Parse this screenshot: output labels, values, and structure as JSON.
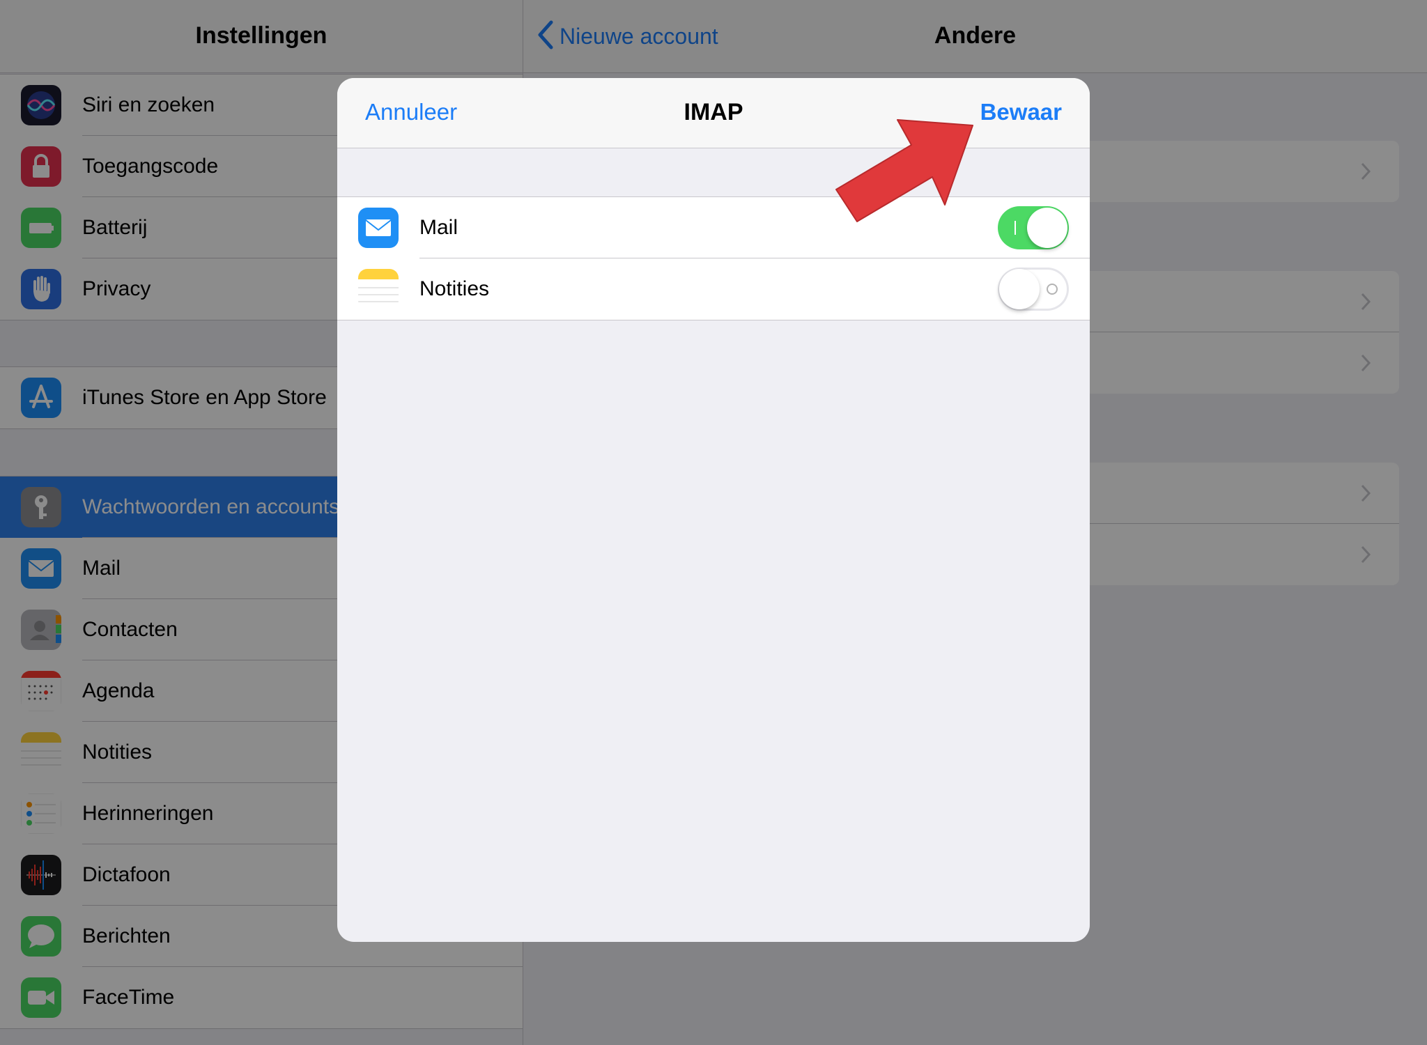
{
  "sidebar": {
    "title": "Instellingen",
    "groups": [
      [
        {
          "label": "Siri en zoeken",
          "icon": "siri-icon"
        },
        {
          "label": "Toegangscode",
          "icon": "lock-icon"
        },
        {
          "label": "Batterij",
          "icon": "battery-icon"
        },
        {
          "label": "Privacy",
          "icon": "hand-icon"
        }
      ],
      [
        {
          "label": "iTunes Store en App Store",
          "icon": "app-store-icon"
        }
      ],
      [
        {
          "label": "Wachtwoorden en accounts",
          "icon": "key-icon",
          "selected": true
        },
        {
          "label": "Mail",
          "icon": "mail-icon"
        },
        {
          "label": "Contacten",
          "icon": "contacts-icon"
        },
        {
          "label": "Agenda",
          "icon": "calendar-icon"
        },
        {
          "label": "Notities",
          "icon": "notes-icon"
        },
        {
          "label": "Herinneringen",
          "icon": "reminders-icon"
        },
        {
          "label": "Dictafoon",
          "icon": "voice-memos-icon"
        },
        {
          "label": "Berichten",
          "icon": "messages-icon"
        },
        {
          "label": "FaceTime",
          "icon": "facetime-icon"
        }
      ]
    ]
  },
  "detail": {
    "back_label": "Nieuwe account",
    "title": "Andere"
  },
  "modal": {
    "cancel_label": "Annuleer",
    "title": "IMAP",
    "save_label": "Bewaar",
    "items": [
      {
        "label": "Mail",
        "icon": "mail-icon",
        "enabled": true
      },
      {
        "label": "Notities",
        "icon": "notes-icon",
        "enabled": false
      }
    ]
  },
  "colors": {
    "accent": "#1c7df7",
    "switch_on": "#4cd964",
    "selected_row": "#2f80ec",
    "arrow": "#e0393b"
  }
}
